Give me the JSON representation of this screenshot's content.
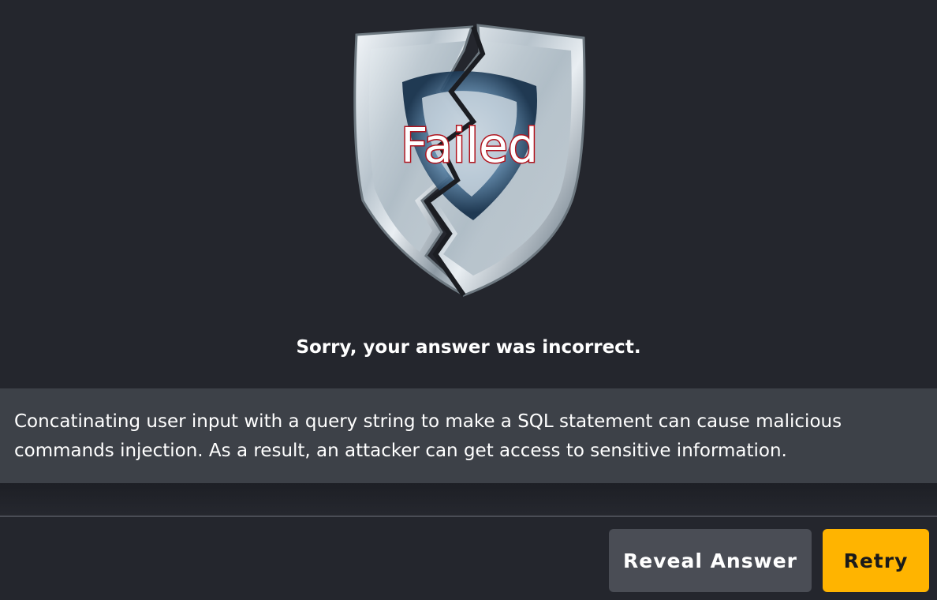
{
  "badge": {
    "icon": "broken-shield-icon",
    "label": "Failed",
    "label_color": "#ffffff",
    "label_outline_color": "#b0141e"
  },
  "result": {
    "message": "Sorry, your answer was incorrect."
  },
  "explanation": {
    "text": "Concatinating user input with a query string to make a SQL statement can cause malicious commands injection. As a result, an attacker can get access to sensitive information."
  },
  "actions": {
    "reveal_label": "Reveal Answer",
    "retry_label": "Retry"
  },
  "colors": {
    "background": "#24262d",
    "panel": "#3d4148",
    "secondary_button": "#4a4d55",
    "primary_button": "#ffb400"
  }
}
